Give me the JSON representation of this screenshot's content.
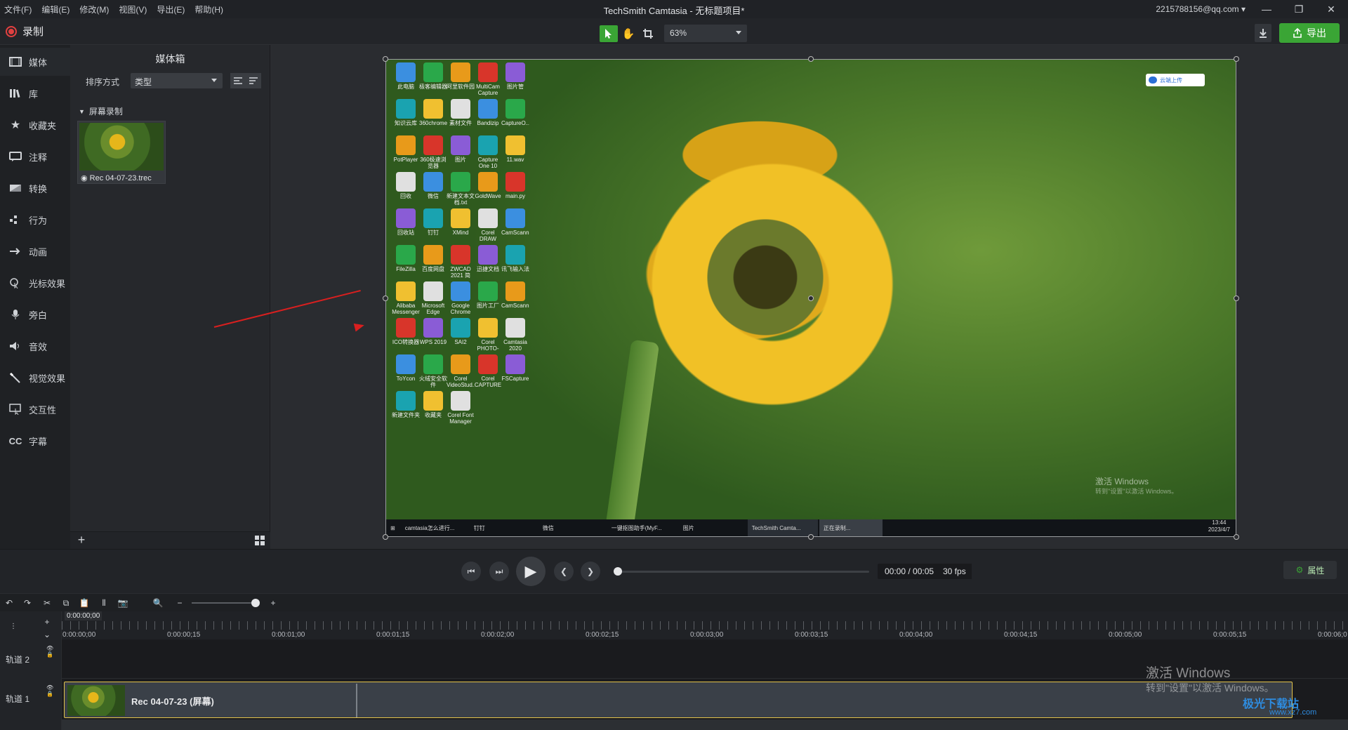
{
  "menu": [
    "文件(F)",
    "编辑(E)",
    "修改(M)",
    "视图(V)",
    "导出(E)",
    "帮助(H)"
  ],
  "app_title": "TechSmith Camtasia - 无标题项目*",
  "account": "2215788156@qq.com",
  "toolbar": {
    "record_label": "录制",
    "zoom_value": "63%",
    "export_label": "导出"
  },
  "sidebar": {
    "items": [
      {
        "label": "媒体",
        "icon": "media-icon"
      },
      {
        "label": "库",
        "icon": "library-icon"
      },
      {
        "label": "收藏夹",
        "icon": "star-icon"
      },
      {
        "label": "注释",
        "icon": "annotation-icon"
      },
      {
        "label": "转换",
        "icon": "transition-icon"
      },
      {
        "label": "行为",
        "icon": "behavior-icon"
      },
      {
        "label": "动画",
        "icon": "animation-icon"
      },
      {
        "label": "光标效果",
        "icon": "cursor-effect-icon"
      },
      {
        "label": "旁白",
        "icon": "mic-icon"
      },
      {
        "label": "音效",
        "icon": "speaker-icon"
      },
      {
        "label": "视觉效果",
        "icon": "wand-icon"
      },
      {
        "label": "交互性",
        "icon": "interactive-icon"
      },
      {
        "label": "字幕",
        "icon": "cc-icon"
      }
    ]
  },
  "mediabin": {
    "title": "媒体箱",
    "sort_label": "排序方式",
    "sort_value": "类型",
    "group_label": "屏幕录制",
    "item_label": "Rec 04-07-23.trec"
  },
  "canvas": {
    "upload_chip": "云端上传",
    "activate_line1": "激活 Windows",
    "activate_line2": "转到\"设置\"以激活 Windows。",
    "desktop_icons": [
      "此电脑",
      "极客编辑器",
      "阿里软件园",
      "MultiCam Capture Lite",
      "图片管",
      "知识云库",
      "360chrome",
      "素材文件",
      "Bandizip",
      "CaptureO...",
      "PotPlayer",
      "360极速浏览器",
      "图片",
      "Capture One 10",
      "11.wav",
      "回收",
      "微信",
      "新建文本文档.txt",
      "GoldWave",
      "main.py",
      "回收站",
      "钉钉",
      "XMind",
      "Corel DRAW",
      "CamScanner",
      "FileZilla",
      "百度网盘",
      "ZWCAD 2021 简体...",
      "迅捷文档",
      "讯飞输入法",
      "Alibaba Messenger",
      "Microsoft Edge",
      "Google Chrome",
      "图片工厂",
      "CamScann...",
      "ICO转换器",
      "WPS 2019",
      "SAI2",
      "Corel PHOTO-P...",
      "Camtasia 2020",
      "ToYcon",
      "火绒安全软件",
      "Corel VideoStud...",
      "Corel CAPTURE",
      "FSCapture",
      "新建文件夹",
      "收藏夹",
      "Corel Font Manager"
    ],
    "taskbar_items": [
      "camtasia怎么进行...",
      "钉钉",
      "微信",
      "一键抠图助手(MyF...",
      "图片",
      "TechSmith Camta...",
      "正在录制..."
    ],
    "taskbar_time": "13:44",
    "taskbar_date": "2023/4/7"
  },
  "playback": {
    "time": "00:00 / 00:05",
    "fps": "30 fps",
    "properties_label": "属性"
  },
  "timeline": {
    "playhead": "0:00:00;00",
    "ticks": [
      "0:00:00;00",
      "0:00:00;15",
      "0:00:01;00",
      "0:00:01;15",
      "0:00:02;00",
      "0:00:02;15",
      "0:00:03;00",
      "0:00:03;15",
      "0:00:04;00",
      "0:00:04;15",
      "0:00:05;00",
      "0:00:05;15",
      "0:00:06;0"
    ],
    "tracks": [
      {
        "label": "轨道 2"
      },
      {
        "label": "轨道 1"
      }
    ],
    "clip_label": "Rec 04-07-23 (屏幕)",
    "activate_line1": "激活 Windows",
    "activate_line2": "转到\"设置\"以激活 Windows。",
    "watermark": "极光下载站",
    "watermark_url": "www.xz7.com"
  },
  "colors": {
    "accent": "#3aa535",
    "record": "#e04040",
    "clip_border": "#e3c44a",
    "arrow": "#d91f1f"
  }
}
